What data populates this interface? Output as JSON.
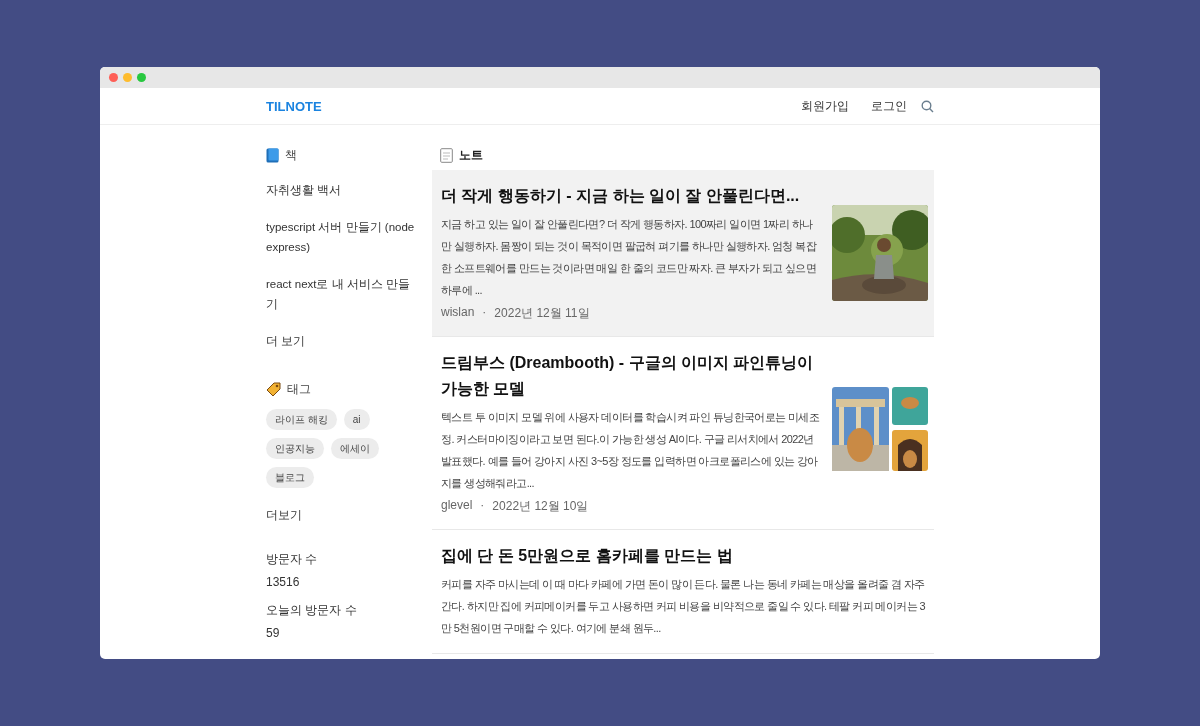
{
  "window": {
    "controls": [
      {
        "color": "#fe5f57"
      },
      {
        "color": "#febc2e"
      },
      {
        "color": "#28c840"
      }
    ]
  },
  "header": {
    "logo": "TILNOTE",
    "links": [
      "회원가입",
      "로그인"
    ]
  },
  "sidebar": {
    "books": {
      "title": "책",
      "items": [
        "자취생활 백서",
        "typescript 서버 만들기 (node express)",
        "react next로 내 서비스 만들기"
      ],
      "more": "더 보기"
    },
    "tags": {
      "title": "태그",
      "items": [
        "라이프 해킹",
        "ai",
        "인공지능",
        "에세이",
        "블로그"
      ],
      "more": "더보기"
    },
    "stats": [
      {
        "label": "방문자 수",
        "value": "13516"
      },
      {
        "label": "오늘의 방문자 수",
        "value": "59"
      }
    ]
  },
  "notes": {
    "title": "노트",
    "items": [
      {
        "title": "더 작게 행동하기 - 지금 하는 일이 잘 안풀린다면...",
        "excerpt": "지금 하고 있는 일이 잘 안풀린다면? 더 작게 행동하자. 100짜리 일이면 1짜리 하나만 실행하자. 몸짱이 되는 것이 목적이면 팔굽혀 펴기를 하나만 실행하자. 엄청 복잡한 소프트웨어를 만드는 것이라면 매일 한 줄의 코드만 짜자. 큰 부자가 되고 싶으면 하루에 ...",
        "author": "wislan",
        "separator": "·",
        "date": "2022년 12월 11일",
        "highlighted": true
      },
      {
        "title": "드림부스 (Dreambooth) - 구글의 이미지 파인튜닝이 가능한 모델",
        "excerpt": "텍스트 투 이미지 모델 위에 사용자 데이터를 학습시켜 파인 튜닝한국어로는 미세조정. 커스터마이징이라고 보면 된다.이 가능한 생성 AI이다. 구글 리서치에서 2022년 발표했다. 예를 들어 강아지 사진 3~5장 정도를 입력하면 아크로폴리스에 있는 강아지를 생성해줘라고...",
        "author": "glevel",
        "separator": "·",
        "date": "2022년 12월 10일",
        "highlighted": false
      },
      {
        "title": "집에 단 돈 5만원으로 홈카페를 만드는 법",
        "excerpt": "커피를 자주 마시는데 이 때 마다 카페에 가면 돈이 많이 든다. 물론 나는 동네 카페는 매상을 올려줄 겸 자주 간다. 하지만 집에 커피메이커를 두고 사용하면 커피 비용을 비약적으로 줄일 수 있다. 테팔 커피 메이커는 3만 5천원이면 구매할 수 있다. 여기에 분쇄 원두...",
        "highlighted": false
      }
    ]
  }
}
